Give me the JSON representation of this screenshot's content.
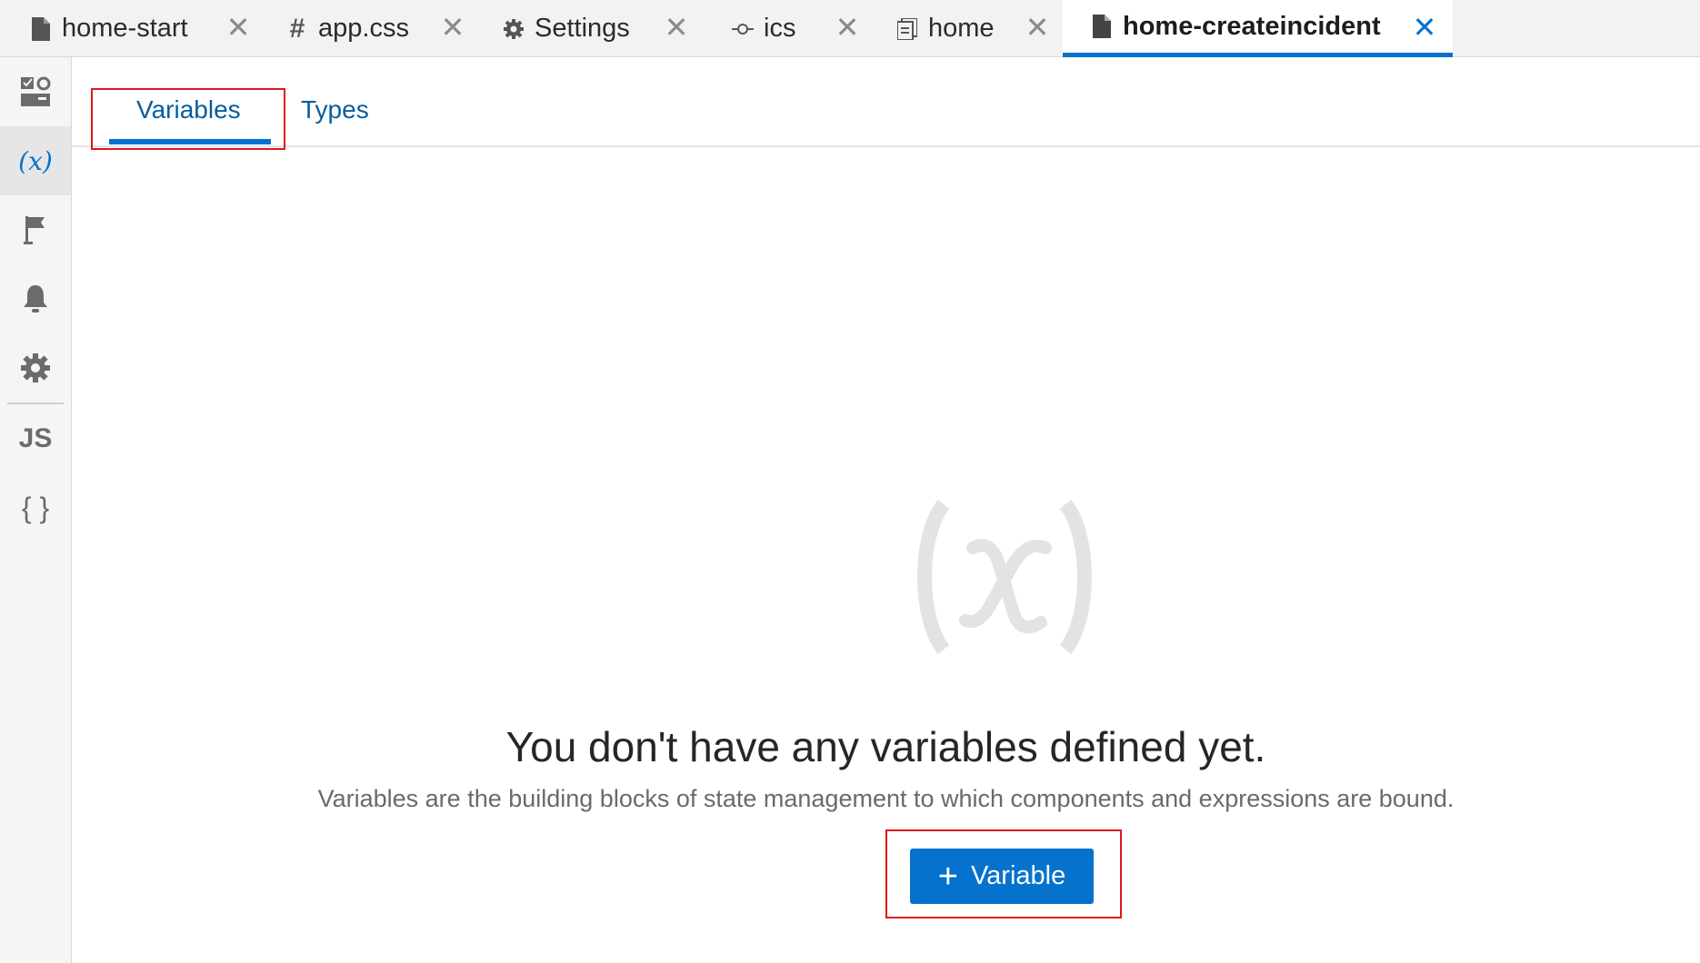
{
  "tabs": [
    {
      "label": "home-start",
      "icon": "file-icon"
    },
    {
      "label": "app.css",
      "icon": "hash-icon"
    },
    {
      "label": "Settings",
      "icon": "gear-icon"
    },
    {
      "label": "ics",
      "icon": "connection-icon"
    },
    {
      "label": "home",
      "icon": "pages-icon"
    },
    {
      "label": "home-createincident",
      "icon": "file-icon",
      "active": true
    }
  ],
  "tab_close_glyph": "✕",
  "rail": {
    "items": [
      "components-icon",
      "variables-icon",
      "flag-icon",
      "bell-icon",
      "gear-icon",
      "js-icon",
      "json-braces-icon"
    ],
    "active": "variables-icon",
    "variables_label": "(x)",
    "js_label": "JS",
    "json_label": "{ }"
  },
  "subtabs": {
    "variables": "Variables",
    "types": "Types"
  },
  "empty_state": {
    "icon_text": "(x)",
    "title": "You don't have any variables defined yet.",
    "description": "Variables are the building blocks of state management to which components and expressions are bound.",
    "button_plus": "+",
    "button_label": "Variable"
  },
  "colors": {
    "accent": "#0572ce",
    "highlight": "#e0151d"
  }
}
